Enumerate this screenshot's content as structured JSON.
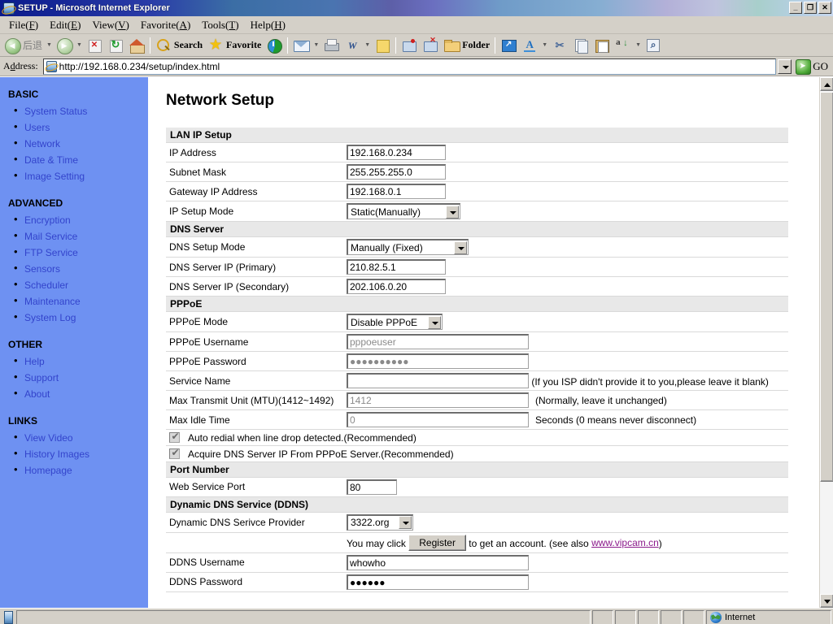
{
  "window": {
    "title": "SETUP - Microsoft Internet Explorer",
    "minimize_label": "–",
    "maximize_label": "❐",
    "close_label": "✕",
    "icon": "ie-logo-icon"
  },
  "menu": {
    "items": [
      {
        "label": "File(F)",
        "text": "File(",
        "key": "F",
        "tail": ")"
      },
      {
        "label": "Edit(E)",
        "text": "Edit(",
        "key": "E",
        "tail": ")"
      },
      {
        "label": "View(V)",
        "text": "View(",
        "key": "V",
        "tail": ")"
      },
      {
        "label": "Favorite(A)",
        "text": "Favorite(",
        "key": "A",
        "tail": ")"
      },
      {
        "label": "Tools(T)",
        "text": "Tools(",
        "key": "T",
        "tail": ")"
      },
      {
        "label": "Help(H)",
        "text": "Help(",
        "key": "H",
        "tail": ")"
      }
    ]
  },
  "toolbar": {
    "back_label": "后退",
    "forward_label": "",
    "search_label": "Search",
    "favorite_label": "Favorite",
    "folder_label": "Folder",
    "icons": [
      "back-icon",
      "forward-icon",
      "stop-icon",
      "refresh-icon",
      "home-icon",
      "search-icon",
      "favorites-star-icon",
      "history-icon",
      "mail-icon",
      "print-icon",
      "word-edit-icon",
      "notes-icon",
      "messenger-icon",
      "messenger-close-icon",
      "folder-icon",
      "fullscreen-icon",
      "font-icon",
      "cut-icon",
      "copy-icon",
      "paste-icon",
      "sort-icon",
      "zoom-icon"
    ]
  },
  "address": {
    "label": "Address:",
    "url": "http://192.168.0.234/setup/index.html",
    "go_label": "GO"
  },
  "sidebar": {
    "groups": [
      {
        "heading": "BASIC",
        "items": [
          {
            "label": "System Status"
          },
          {
            "label": "Users"
          },
          {
            "label": "Network"
          },
          {
            "label": "Date & Time"
          },
          {
            "label": "Image Setting"
          }
        ]
      },
      {
        "heading": "ADVANCED",
        "items": [
          {
            "label": "Encryption"
          },
          {
            "label": "Mail Service"
          },
          {
            "label": "FTP Service"
          },
          {
            "label": "Sensors"
          },
          {
            "label": "Scheduler"
          },
          {
            "label": "Maintenance"
          },
          {
            "label": "System Log"
          }
        ]
      },
      {
        "heading": "OTHER",
        "items": [
          {
            "label": "Help"
          },
          {
            "label": "Support"
          },
          {
            "label": "About"
          }
        ]
      },
      {
        "heading": "LINKS",
        "items": [
          {
            "label": "View Video"
          },
          {
            "label": "History Images"
          },
          {
            "label": "Homepage"
          }
        ]
      }
    ]
  },
  "main": {
    "title": "Network Setup",
    "sections": {
      "lan": {
        "heading": "LAN IP Setup",
        "ip_address_label": "IP Address",
        "ip_address_value": "192.168.0.234",
        "subnet_mask_label": "Subnet Mask",
        "subnet_mask_value": "255.255.255.0",
        "gateway_label": "Gateway IP Address",
        "gateway_value": "192.168.0.1",
        "ip_setup_mode_label": "IP Setup Mode",
        "ip_setup_mode_value": "Static(Manually)"
      },
      "dns": {
        "heading": "DNS Server",
        "dns_setup_mode_label": "DNS Setup Mode",
        "dns_setup_mode_value": "Manually (Fixed)",
        "primary_label": "DNS Server IP (Primary)",
        "primary_value": "210.82.5.1",
        "secondary_label": "DNS Server IP (Secondary)",
        "secondary_value": "202.106.0.20"
      },
      "pppoe": {
        "heading": "PPPoE",
        "mode_label": "PPPoE Mode",
        "mode_value": "Disable PPPoE",
        "username_label": "PPPoE Username",
        "username_value": "pppoeuser",
        "password_label": "PPPoE Password",
        "password_value": "●●●●●●●●●●",
        "service_name_label": "Service Name",
        "service_name_value": "",
        "service_name_hint": "(If you ISP didn't provide it to you,please leave it blank)",
        "mtu_label": "Max Transmit Unit (MTU)(1412~1492)",
        "mtu_value": "1412",
        "mtu_hint": "(Normally, leave it unchanged)",
        "idle_label": "Max Idle Time",
        "idle_value": "0",
        "idle_hint": "Seconds (0 means never disconnect)",
        "auto_redial_label": "Auto redial when line drop detected.(Recommended)",
        "auto_redial_checked": true,
        "acquire_dns_label": "Acquire DNS Server IP From PPPoE Server.(Recommended)",
        "acquire_dns_checked": true
      },
      "port": {
        "heading": "Port Number",
        "web_port_label": "Web Service Port",
        "web_port_value": "80"
      },
      "ddns": {
        "heading": "Dynamic DNS Service (DDNS)",
        "provider_label": "Dynamic DNS Serivce Provider",
        "provider_value": "3322.org",
        "register_prefix": "You may click",
        "register_button": "Register",
        "register_suffix": "to get an account. (see also",
        "register_link": "www.vipcam.cn",
        "register_end": ")",
        "username_label": "DDNS Username",
        "username_value": "whowho",
        "password_label": "DDNS Password",
        "password_value": "●●●●●●"
      }
    }
  },
  "statusbar": {
    "message": "",
    "zone": "Internet"
  },
  "colors": {
    "sidebar_bg": "#6e91f2",
    "link": "#3344cc",
    "section_header_bg": "#e8e8e8",
    "external_link": "#8b1a8b",
    "chrome": "#d4d0c8"
  }
}
